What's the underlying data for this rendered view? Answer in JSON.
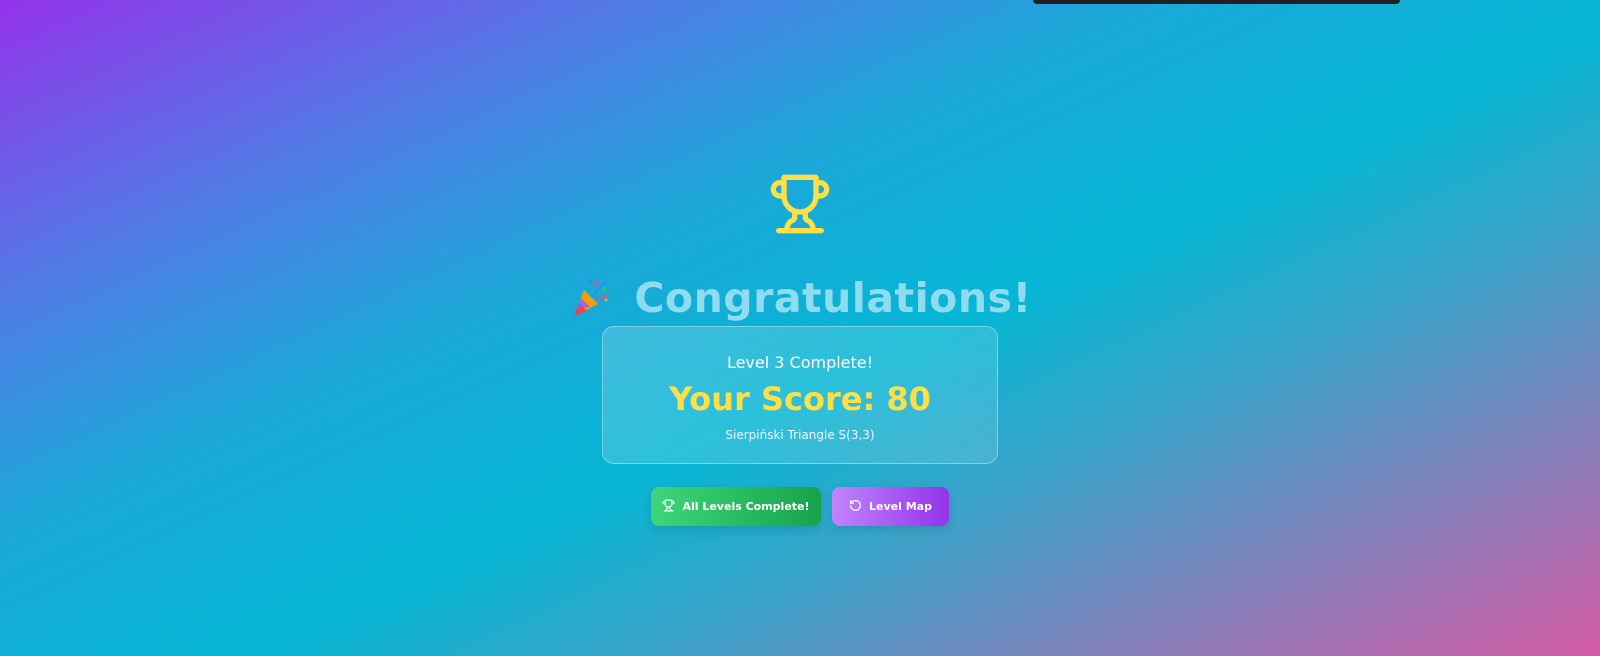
{
  "header": {
    "icon": "trophy-icon",
    "title_icon": "party-popper-icon",
    "title": "Congratulations!"
  },
  "result": {
    "level_text": "Level 3 Complete!",
    "score_text": "Your Score: 80",
    "puzzle_name": "Sierpiński Triangle S(3,3)"
  },
  "actions": {
    "primary": {
      "label": "All Levels Complete!",
      "icon": "trophy-icon",
      "color": "#22c55e"
    },
    "secondary": {
      "label": "Level Map",
      "icon": "rotate-ccw-icon",
      "color": "#a855f7"
    }
  },
  "colors": {
    "accent_yellow": "#fde047",
    "title": "#8fdcf0"
  }
}
